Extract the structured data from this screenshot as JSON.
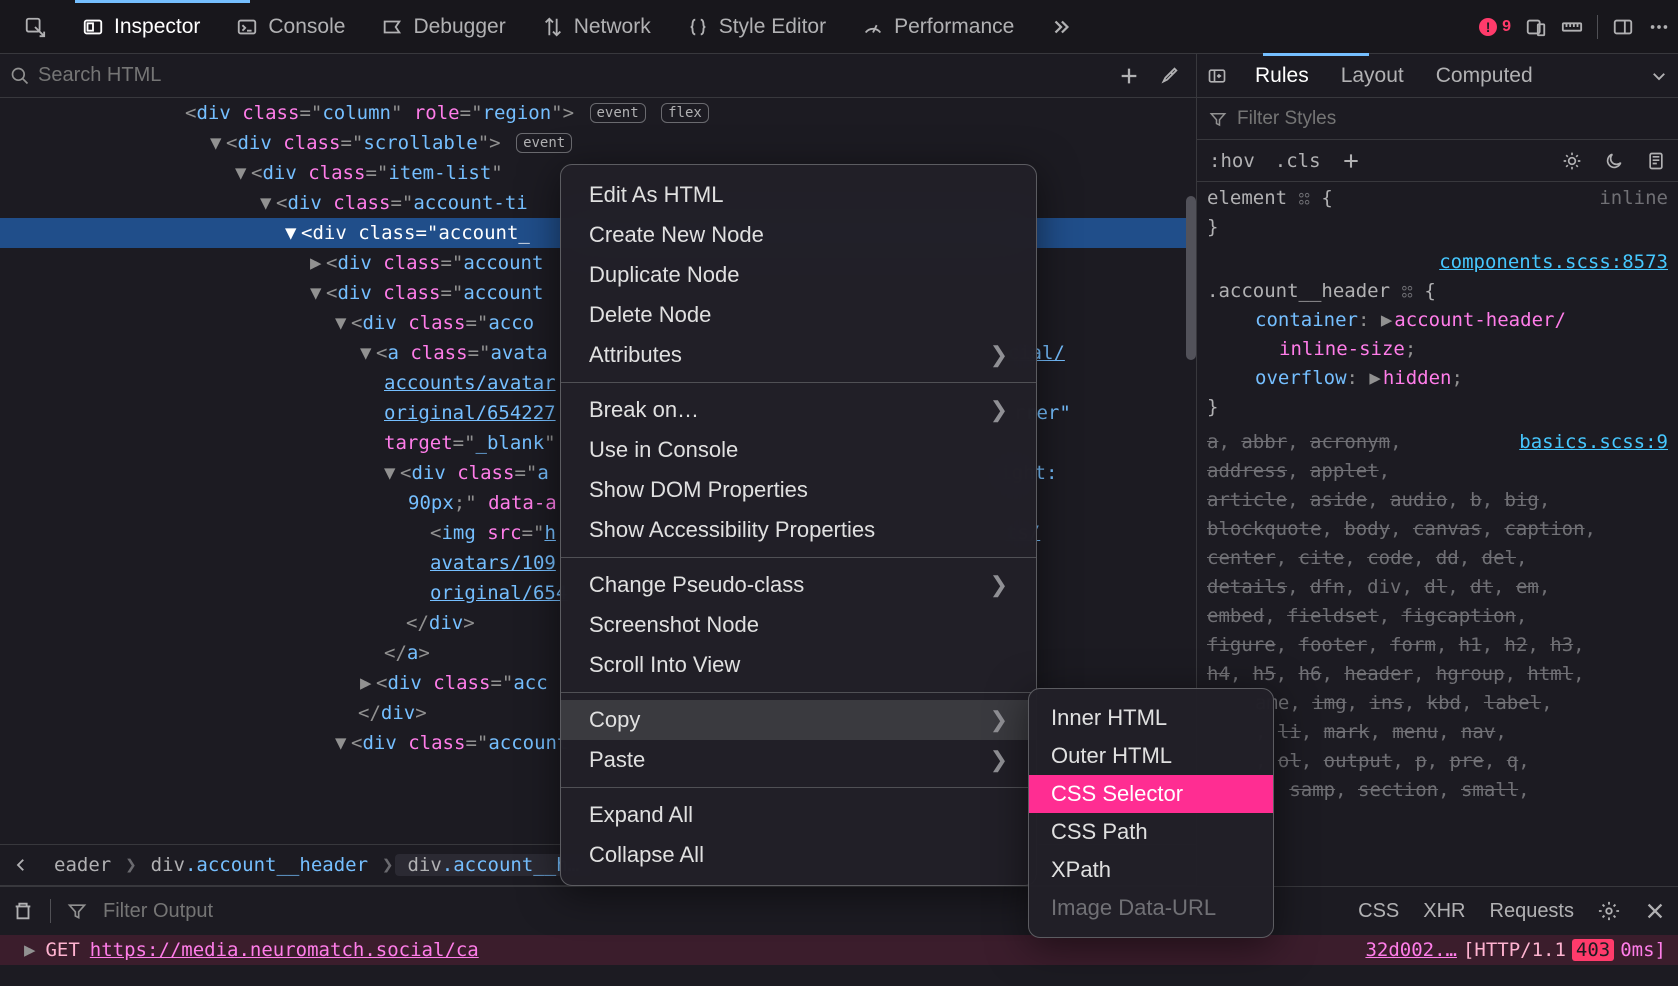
{
  "toolbar": {
    "inspector": "Inspector",
    "console": "Console",
    "debugger": "Debugger",
    "network": "Network",
    "style_editor": "Style Editor",
    "performance": "Performance",
    "errors": "9"
  },
  "search_placeholder": "Search HTML",
  "dom": {
    "l0": "<div class=\"column\" role=\"region\">",
    "badge_event": "event",
    "badge_flex": "flex",
    "l1": "<div class=\"scrollable\">",
    "l2": "<div class=\"item-list\"",
    "l3": "<div class=\"account-ti",
    "l4": "<div class=\"account_",
    "l5": "<div class=\"account",
    "l6": "<div class=\"account",
    "l7": "<div class=\"acco",
    "l8a": "<a class=\"avata",
    "l8b": "accounts/avatar",
    "l8c": "original/654227",
    "l8d": "target=\"_blank\"",
    "l9a": "<div class=\"a",
    "l9a_suffix": "eight:",
    "l9b": "90px;\" data-a",
    "l10a": "<img src=\"h",
    "l10a_suffix": "ts/",
    "l10b": "avatars/109",
    "l10c": "original/654",
    "l11": "</div>",
    "l12": "</a>",
    "l13": "<div class=\"acc",
    "l14": "</div>",
    "l15": "<div class=\"account",
    "href_text": "cial/",
    "rel_text": "rrer\""
  },
  "breadcrumb": {
    "c1_txt": "eader",
    "c2_tag": "div",
    "c2_cls": ".account__header",
    "c3_tag": "div",
    "c3_cls": ".account__h…"
  },
  "rules_tabs": {
    "rules": "Rules",
    "layout": "Layout",
    "computed": "Computed"
  },
  "filter_styles": "Filter Styles",
  "toggles": {
    "hov": ":hov",
    "cls": ".cls"
  },
  "rules": {
    "element_sel": "element",
    "inline": "inline",
    "src1": "components.scss:8573",
    "sel1": ".account__header",
    "p1n": "container",
    "p1v": "account-header/",
    "p1v2": "inline-size",
    "p2n": "overflow",
    "p2v": "hidden",
    "src2": "basics.scss:9",
    "reset": "a, abbr, acronym, address, applet, article, aside, audio, b, big, blockquote, body, canvas, caption, center, cite, code, dd, del, details, dfn, div, dl, dt, em, embed, fieldset, figcaption, figure, footer, form, h1, h2, h3, h4, h5, h6, header, hgroup, html, i, iframe, img, ins, kbd, label, legend, li, mark, menu, nav, object, ol, output, p, pre, q, ruby, s, samp, section, small,"
  },
  "context_menu": {
    "edit_html": "Edit As HTML",
    "create_node": "Create New Node",
    "duplicate": "Duplicate Node",
    "delete": "Delete Node",
    "attributes": "Attributes",
    "break": "Break on…",
    "use_console": "Use in Console",
    "show_dom": "Show DOM Properties",
    "show_a11y": "Show Accessibility Properties",
    "pseudo": "Change Pseudo-class",
    "screenshot": "Screenshot Node",
    "scroll": "Scroll Into View",
    "copy": "Copy",
    "paste": "Paste",
    "expand": "Expand All",
    "collapse": "Collapse All"
  },
  "copy_submenu": {
    "inner": "Inner HTML",
    "outer": "Outer HTML",
    "css_sel": "CSS Selector",
    "css_path": "CSS Path",
    "xpath": "XPath",
    "data_url": "Image Data-URL"
  },
  "console": {
    "filter_output": "Filter Output",
    "css": "CSS",
    "xhr": "XHR",
    "requests": "Requests",
    "method": "GET",
    "url": "https://media.neuromatch.social/ca",
    "trail": "32d002.…",
    "http": "[HTTP/1.1",
    "code": "403",
    "ms": "0ms]"
  }
}
